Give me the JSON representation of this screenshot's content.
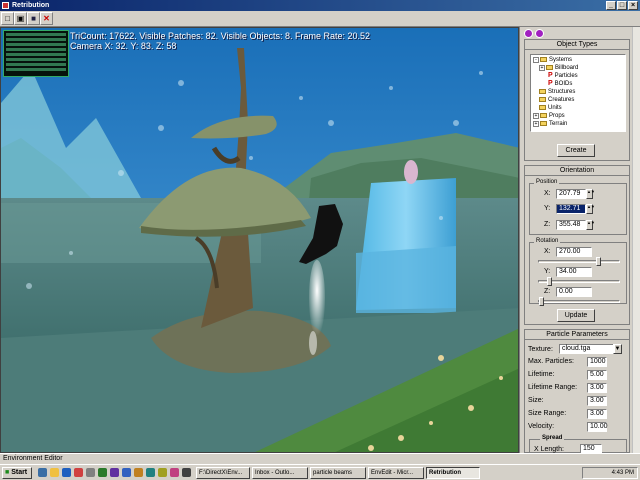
{
  "window": {
    "title": "Retribution"
  },
  "toolbar": {
    "icons": [
      "new-file-icon",
      "open-folder-icon",
      "save-icon",
      "close-icon"
    ],
    "glyphs": [
      "□",
      "▣",
      "■",
      "✕"
    ]
  },
  "hud": {
    "line1": "TriCount: 17622. Visible Patches: 82. Visible Objects: 8. Frame Rate: 20.52",
    "line2": "Camera X: 32. Y: 83. Z: 58"
  },
  "object_types": {
    "title": "Object Types",
    "items": [
      {
        "label": "Systems",
        "kind": "folder",
        "expand": "-"
      },
      {
        "label": "Billboard",
        "kind": "folder",
        "expand": "+"
      },
      {
        "label": "Particles",
        "kind": "p"
      },
      {
        "label": "BOIDs",
        "kind": "p"
      },
      {
        "label": "Structures",
        "kind": "folder"
      },
      {
        "label": "Creatures",
        "kind": "folder"
      },
      {
        "label": "Units",
        "kind": "folder"
      },
      {
        "label": "Props",
        "kind": "folder",
        "expand": "+"
      },
      {
        "label": "Terrain",
        "kind": "folder",
        "expand": "+"
      }
    ],
    "create_label": "Create"
  },
  "orientation": {
    "title": "Orientation",
    "position_label": "Position",
    "x_label": "X:",
    "x_value": "207.79",
    "y_label": "Y:",
    "y_value": "132.71",
    "z_label": "Z:",
    "z_value": "355.48",
    "rotation_label": "Rotation",
    "rx_label": "X:",
    "rx_value": "270.00",
    "rx_level": 0.75,
    "ry_label": "Y:",
    "ry_value": "34.00",
    "ry_level": 0.1,
    "rz_label": "Z:",
    "rz_value": "0.00",
    "rz_level": 0.0,
    "update_label": "Update"
  },
  "particle_parameters": {
    "title": "Particle Parameters",
    "texture_label": "Texture:",
    "texture_value": "cloud.tga",
    "fields": [
      {
        "label": "Max. Particles:",
        "value": "1000"
      },
      {
        "label": "Lifetime:",
        "value": "5.00"
      },
      {
        "label": "Lifetime Range:",
        "value": "3.00"
      },
      {
        "label": "Size:",
        "value": "3.00"
      },
      {
        "label": "Size Range:",
        "value": "3.00"
      },
      {
        "label": "Velocity:",
        "value": "10.00"
      }
    ],
    "spread_label": "Spread",
    "spread_x_label": "X Length:",
    "spread_x_value": "150"
  },
  "status": {
    "text": "Environment Editor"
  },
  "taskbar": {
    "start_label": "Start",
    "tasks": [
      {
        "label": "F:\\DirectX\\Env...",
        "active": false
      },
      {
        "label": "Inbox - Outlo...",
        "active": false
      },
      {
        "label": "particle beams",
        "active": false
      },
      {
        "label": "EnvEdit - Micr...",
        "active": false
      },
      {
        "label": "Retribution",
        "active": true
      }
    ],
    "clock": "4:43 PM"
  },
  "colors": {
    "title_bar": "#0a246a",
    "rollout_accent": "#a020c0",
    "hud_text": "#ffffff"
  }
}
